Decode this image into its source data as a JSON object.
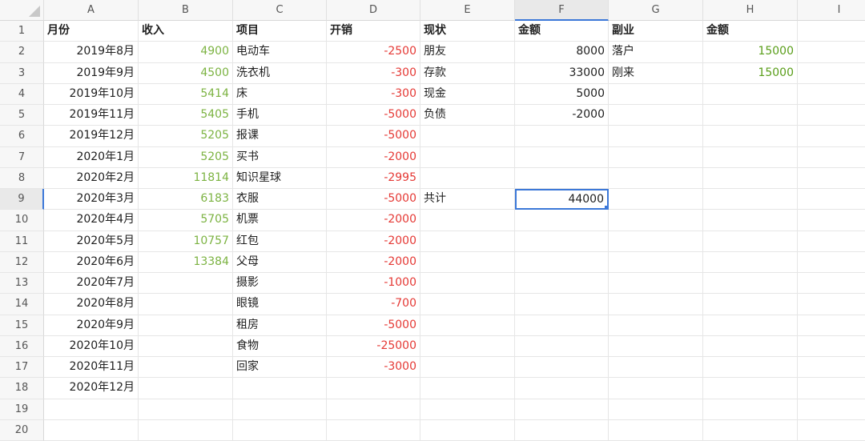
{
  "columns": [
    "A",
    "B",
    "C",
    "D",
    "E",
    "F",
    "G",
    "H",
    "I"
  ],
  "rows": [
    "1",
    "2",
    "3",
    "4",
    "5",
    "6",
    "7",
    "8",
    "9",
    "10",
    "11",
    "12",
    "13",
    "14",
    "15",
    "16",
    "17",
    "18",
    "19",
    "20"
  ],
  "cells": {
    "A": [
      "月份",
      "2019年8月",
      "2019年9月",
      "2019年10月",
      "2019年11月",
      "2019年12月",
      "2020年1月",
      "2020年2月",
      "2020年3月",
      "2020年4月",
      "2020年5月",
      "2020年6月",
      "2020年7月",
      "2020年8月",
      "2020年9月",
      "2020年10月",
      "2020年11月",
      "2020年12月",
      "",
      ""
    ],
    "B": [
      "收入",
      "4900",
      "4500",
      "5414",
      "5405",
      "5205",
      "5205",
      "11814",
      "6183",
      "5705",
      "10757",
      "13384",
      "",
      "",
      "",
      "",
      "",
      "",
      "",
      ""
    ],
    "C": [
      "项目",
      "电动车",
      "洗衣机",
      "床",
      "手机",
      "报课",
      "买书",
      "知识星球",
      "衣服",
      "机票",
      "红包",
      "父母",
      "摄影",
      "眼镜",
      "租房",
      "食物",
      "回家",
      "",
      "",
      ""
    ],
    "D": [
      "开销",
      "-2500",
      "-300",
      "-300",
      "-5000",
      "-5000",
      "-2000",
      "-2995",
      "-5000",
      "-2000",
      "-2000",
      "-2000",
      "-1000",
      "-700",
      "-5000",
      "-25000",
      "-3000",
      "",
      "",
      ""
    ],
    "E": [
      "现状",
      "朋友",
      "存款",
      "现金",
      "负债",
      "",
      "",
      "",
      "共计",
      "",
      "",
      "",
      "",
      "",
      "",
      "",
      "",
      "",
      "",
      ""
    ],
    "F": [
      "金额",
      "8000",
      "33000",
      "5000",
      "-2000",
      "",
      "",
      "",
      "44000",
      "",
      "",
      "",
      "",
      "",
      "",
      "",
      "",
      "",
      "",
      ""
    ],
    "G": [
      "副业",
      "落户",
      "刚来",
      "",
      "",
      "",
      "",
      "",
      "",
      "",
      "",
      "",
      "",
      "",
      "",
      "",
      "",
      "",
      "",
      ""
    ],
    "H": [
      "金额",
      "15000",
      "15000",
      "",
      "",
      "",
      "",
      "",
      "",
      "",
      "",
      "",
      "",
      "",
      "",
      "",
      "",
      "",
      "",
      ""
    ],
    "I": [
      "",
      "",
      "",
      "",
      "",
      "",
      "",
      "",
      "",
      "",
      "",
      "",
      "",
      "",
      "",
      "",
      "",
      "",
      "",
      ""
    ]
  },
  "selection": {
    "column": "F",
    "row": "9"
  },
  "colors": {
    "selection": "#3c78d8",
    "income": "#7cb342",
    "expense": "#e53935",
    "side_income": "#5a9e1a"
  }
}
